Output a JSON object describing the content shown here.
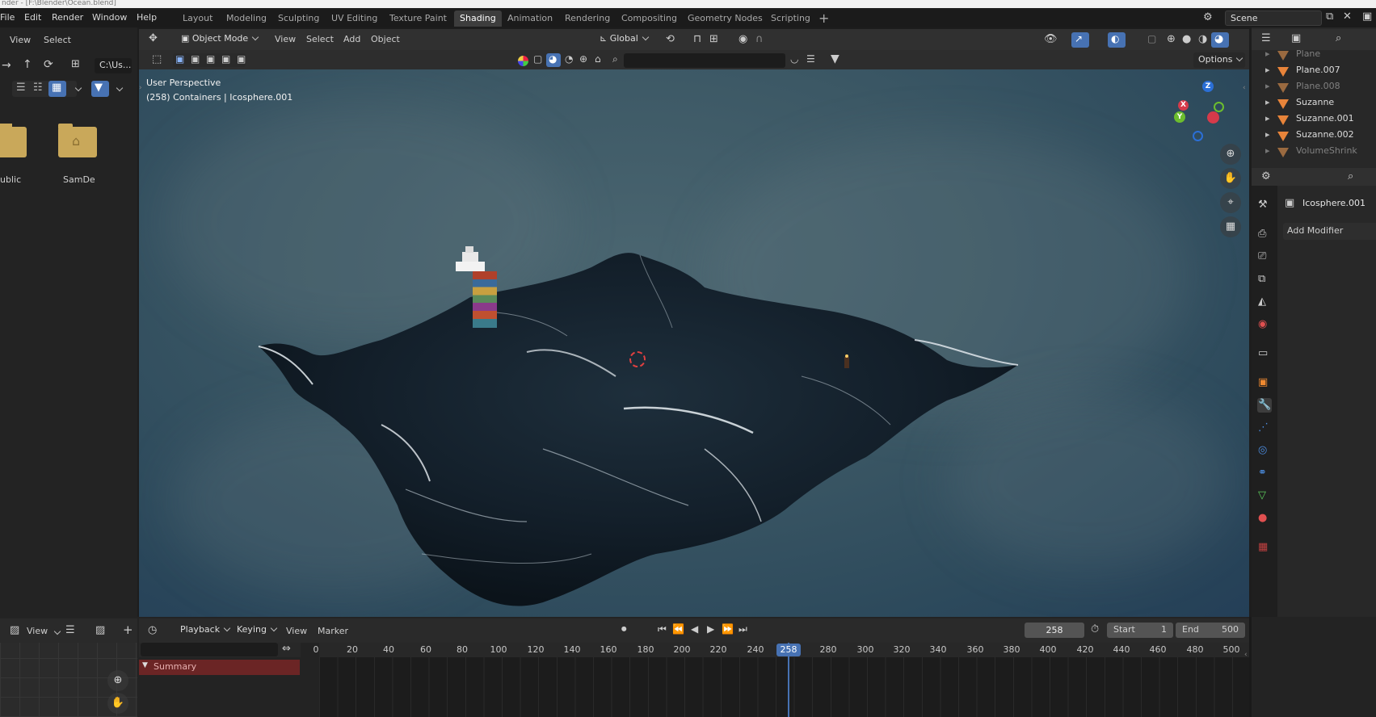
{
  "titlebar": {
    "text": "nder - [F:\\Blender\\Ocean.blend]"
  },
  "menu": [
    "File",
    "Edit",
    "Render",
    "Window",
    "Help"
  ],
  "workspaces": [
    "Layout",
    "Modeling",
    "Sculpting",
    "UV Editing",
    "Texture Paint",
    "Shading",
    "Animation",
    "Rendering",
    "Compositing",
    "Geometry Nodes",
    "Scripting"
  ],
  "active_workspace": "Shading",
  "scene": {
    "label": "Scene"
  },
  "file_browser": {
    "menu": [
      "View",
      "Select"
    ],
    "path": "C:\\Us...",
    "folders": [
      "ublic",
      "SamDe"
    ]
  },
  "viewport": {
    "mode": "Object Mode",
    "menu": [
      "View",
      "Select",
      "Add",
      "Object"
    ],
    "orientation": "Global",
    "options_label": "Options",
    "overlay_line1": "User Perspective",
    "overlay_line2": "(258) Containers | Icosphere.001",
    "gizmo": {
      "x": "X",
      "y": "Y",
      "z": "Z"
    }
  },
  "outliner": {
    "items": [
      {
        "name": "Plane",
        "dim": true
      },
      {
        "name": "Plane.007",
        "dim": false
      },
      {
        "name": "Plane.008",
        "dim": true
      },
      {
        "name": "Suzanne",
        "dim": false
      },
      {
        "name": "Suzanne.001",
        "dim": false
      },
      {
        "name": "Suzanne.002",
        "dim": false
      },
      {
        "name": "VolumeShrink",
        "dim": true
      }
    ]
  },
  "properties": {
    "object_name": "Icosphere.001",
    "add_modifier": "Add Modifier"
  },
  "timeline": {
    "left_view": "View",
    "menu": [
      "Playback",
      "Keying",
      "View",
      "Marker"
    ],
    "current_frame": "258",
    "start_label": "Start",
    "start_value": "1",
    "end_label": "End",
    "end_value": "500",
    "ticks": [
      "0",
      "20",
      "40",
      "60",
      "80",
      "100",
      "120",
      "140",
      "160",
      "180",
      "200",
      "220",
      "240",
      "280",
      "300",
      "320",
      "340",
      "360",
      "380",
      "400",
      "420",
      "440",
      "460",
      "480",
      "500"
    ],
    "playhead_frame": "258",
    "summary": "Summary"
  }
}
